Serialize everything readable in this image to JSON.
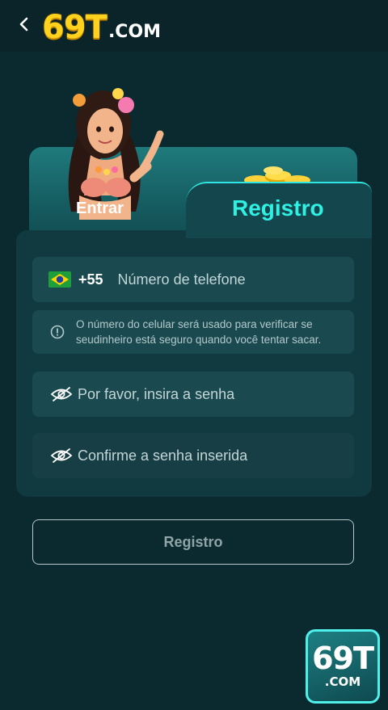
{
  "header": {
    "logo_main": "69T",
    "logo_suffix": ".COM"
  },
  "tabs": {
    "login_label": "Entrar",
    "register_label": "Registro",
    "active": "Registro"
  },
  "form": {
    "phone": {
      "country_code": "+55",
      "flag": "brazil-flag-icon",
      "placeholder": "Número de telefone"
    },
    "hint": "O número do celular será usado para verificar se seudinheiro está seguro quando você tentar sacar.",
    "password": {
      "placeholder": "Por favor, insira a senha"
    },
    "confirm_password": {
      "placeholder": "Confirme a senha inserida"
    },
    "submit_label": "Registro"
  },
  "floating_badge": {
    "main": "69T",
    "suffix": ".COM"
  },
  "colors": {
    "background": "#0b2a30",
    "accent": "#2ff0e2",
    "logo_yellow": "#ffd21e",
    "field_bg": "#1a4a50"
  }
}
